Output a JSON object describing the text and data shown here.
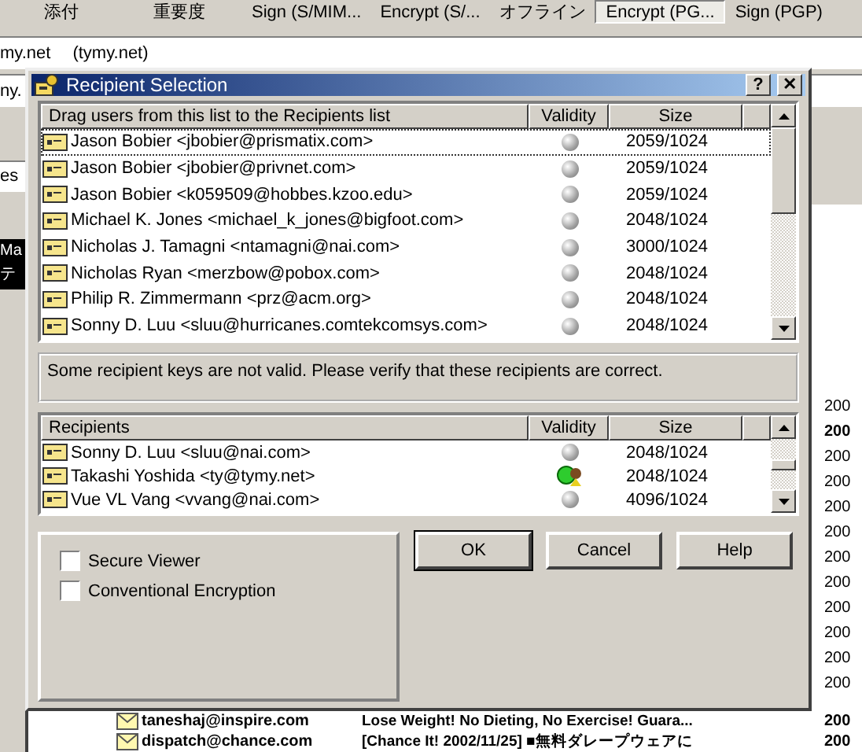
{
  "toolbar": [
    {
      "label": "添付",
      "selected": false
    },
    {
      "label": "重要度",
      "selected": false
    },
    {
      "label": "Sign (S/MIM...",
      "selected": false
    },
    {
      "label": "Encrypt (S/...",
      "selected": false
    },
    {
      "label": "オフライン",
      "selected": false
    },
    {
      "label": "Encrypt (PG...",
      "selected": true
    },
    {
      "label": "Sign (PGP)",
      "selected": false
    }
  ],
  "to_field": {
    "address": "my.net",
    "display": "(tymy.net)"
  },
  "cc_field": {
    "address": "ny."
  },
  "subject_field": {
    "value": "es"
  },
  "folder_pane": {
    "lines": [
      "Ma",
      "テ"
    ]
  },
  "messages": [
    {
      "date": "200",
      "bold": false
    },
    {
      "date": "200",
      "bold": true
    },
    {
      "date": "200",
      "bold": false
    },
    {
      "date": "200",
      "bold": false
    },
    {
      "date": "200",
      "bold": false
    },
    {
      "date": "200",
      "bold": false
    },
    {
      "date": "200",
      "bold": false
    },
    {
      "date": "200",
      "bold": false
    },
    {
      "date": "200",
      "bold": false
    },
    {
      "date": "200",
      "bold": false
    },
    {
      "date": "200",
      "bold": false
    },
    {
      "date": "200",
      "bold": false
    },
    {
      "from": "taneshaj@inspire.com",
      "subject": "Lose Weight! No Dieting, No Exercise! Guara...",
      "date": "200",
      "bold": true
    },
    {
      "from": "dispatch@chance.com",
      "subject": "[Chance It! 2002/11/25] ■無料ダレープウェアに",
      "date": "200",
      "bold": true
    }
  ],
  "dialog": {
    "title": "Recipient Selection",
    "help_button": "?",
    "close_button": "✕",
    "keys_list": {
      "columns": [
        "Drag users from this list to the Recipients list",
        "Validity",
        "Size"
      ],
      "rows": [
        {
          "name": "Jason Bobier <jbobier@prismatix.com>",
          "valid": false,
          "size": "2059/1024",
          "focused": true
        },
        {
          "name": "Jason Bobier <jbobier@privnet.com>",
          "valid": false,
          "size": "2059/1024",
          "focused": false
        },
        {
          "name": "Jason Bobier <k059509@hobbes.kzoo.edu>",
          "valid": false,
          "size": "2059/1024",
          "focused": false
        },
        {
          "name": "Michael K. Jones <michael_k_jones@bigfoot.com>",
          "valid": false,
          "size": "2048/1024",
          "focused": false
        },
        {
          "name": "Nicholas J. Tamagni <ntamagni@nai.com>",
          "valid": false,
          "size": "3000/1024",
          "focused": false
        },
        {
          "name": "Nicholas Ryan <merzbow@pobox.com>",
          "valid": false,
          "size": "2048/1024",
          "focused": false
        },
        {
          "name": "Philip R. Zimmermann <prz@acm.org>",
          "valid": false,
          "size": "2048/1024",
          "focused": false
        },
        {
          "name": "Sonny D. Luu <sluu@hurricanes.comtekcomsys.com>",
          "valid": false,
          "size": "2048/1024",
          "focused": false
        }
      ]
    },
    "message": "Some recipient keys are not valid. Please verify that these recipients are correct.",
    "recipients_list": {
      "columns": [
        "Recipients",
        "Validity",
        "Size"
      ],
      "rows": [
        {
          "name": "Sonny D. Luu <sluu@nai.com>",
          "valid": false,
          "size": "2048/1024",
          "focused": false
        },
        {
          "name": "Takashi Yoshida <ty@tymy.net>",
          "valid": true,
          "size": "2048/1024",
          "focused": false
        },
        {
          "name": "Vue VL Vang <vvang@nai.com>",
          "valid": false,
          "size": "4096/1024",
          "focused": false
        }
      ]
    },
    "options": [
      {
        "label": "Secure Viewer",
        "checked": false
      },
      {
        "label": "Conventional Encryption",
        "checked": false
      }
    ],
    "buttons": [
      {
        "label": "OK",
        "default": true
      },
      {
        "label": "Cancel",
        "default": false
      },
      {
        "label": "Help",
        "default": false
      }
    ]
  }
}
